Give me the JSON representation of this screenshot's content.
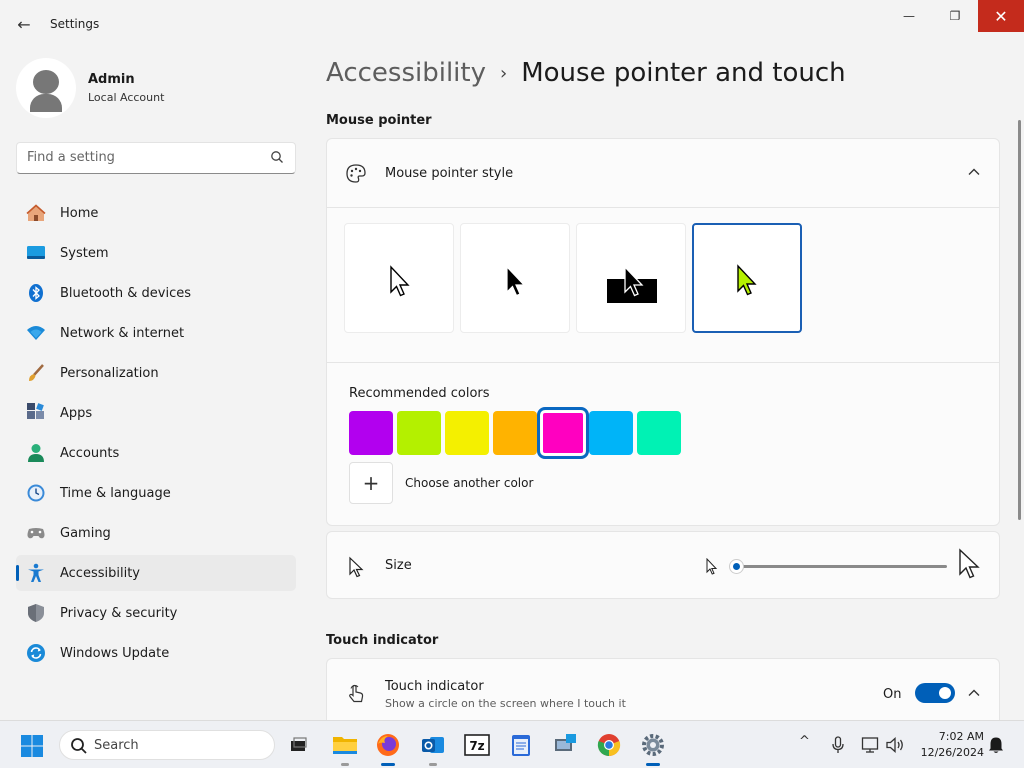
{
  "window": {
    "app_title": "Settings",
    "back_glyph": "←",
    "minimize_glyph": "—",
    "maximize_glyph": "❐",
    "close_glyph": "✕"
  },
  "profile": {
    "name": "Admin",
    "account_type": "Local Account"
  },
  "search": {
    "placeholder": "Find a setting"
  },
  "nav": {
    "items": [
      {
        "label": "Home",
        "icon": "home-icon"
      },
      {
        "label": "System",
        "icon": "system-icon"
      },
      {
        "label": "Bluetooth & devices",
        "icon": "bluetooth-icon"
      },
      {
        "label": "Network & internet",
        "icon": "wifi-icon"
      },
      {
        "label": "Personalization",
        "icon": "brush-icon"
      },
      {
        "label": "Apps",
        "icon": "apps-icon"
      },
      {
        "label": "Accounts",
        "icon": "accounts-icon"
      },
      {
        "label": "Time & language",
        "icon": "clock-icon"
      },
      {
        "label": "Gaming",
        "icon": "gamepad-icon"
      },
      {
        "label": "Accessibility",
        "icon": "accessibility-icon",
        "active": true
      },
      {
        "label": "Privacy & security",
        "icon": "shield-icon"
      },
      {
        "label": "Windows Update",
        "icon": "update-icon"
      }
    ]
  },
  "breadcrumb": {
    "parent": "Accessibility",
    "separator": "›",
    "current": "Mouse pointer and touch"
  },
  "mouse_pointer": {
    "section_title": "Mouse pointer",
    "style_label": "Mouse pointer style",
    "styles": [
      "white",
      "black",
      "inverted",
      "custom"
    ],
    "selected_style": "custom",
    "recommended_label": "Recommended colors",
    "colors": [
      "#b200ef",
      "#b4f000",
      "#f4f000",
      "#ffb300",
      "#ff00c0",
      "#00b4f8",
      "#00f2b4"
    ],
    "selected_color": "#ff00c0",
    "add_color_glyph": "+",
    "choose_color_label": "Choose another color",
    "size_label": "Size",
    "size_value": 1
  },
  "touch": {
    "section_title": "Touch indicator",
    "label": "Touch indicator",
    "description": "Show a circle on the screen where I touch it",
    "state_label": "On",
    "enabled": true
  },
  "taskbar": {
    "search_label": "Search",
    "time": "7:02 AM",
    "date": "12/26/2024",
    "tray_chevron": "^",
    "apps": [
      "file-explorer-icon",
      "firefox-icon",
      "outlook-icon",
      "7zip-icon",
      "notepad-icon",
      "remote-desktop-icon",
      "chrome-icon",
      "settings-gear-icon"
    ]
  }
}
